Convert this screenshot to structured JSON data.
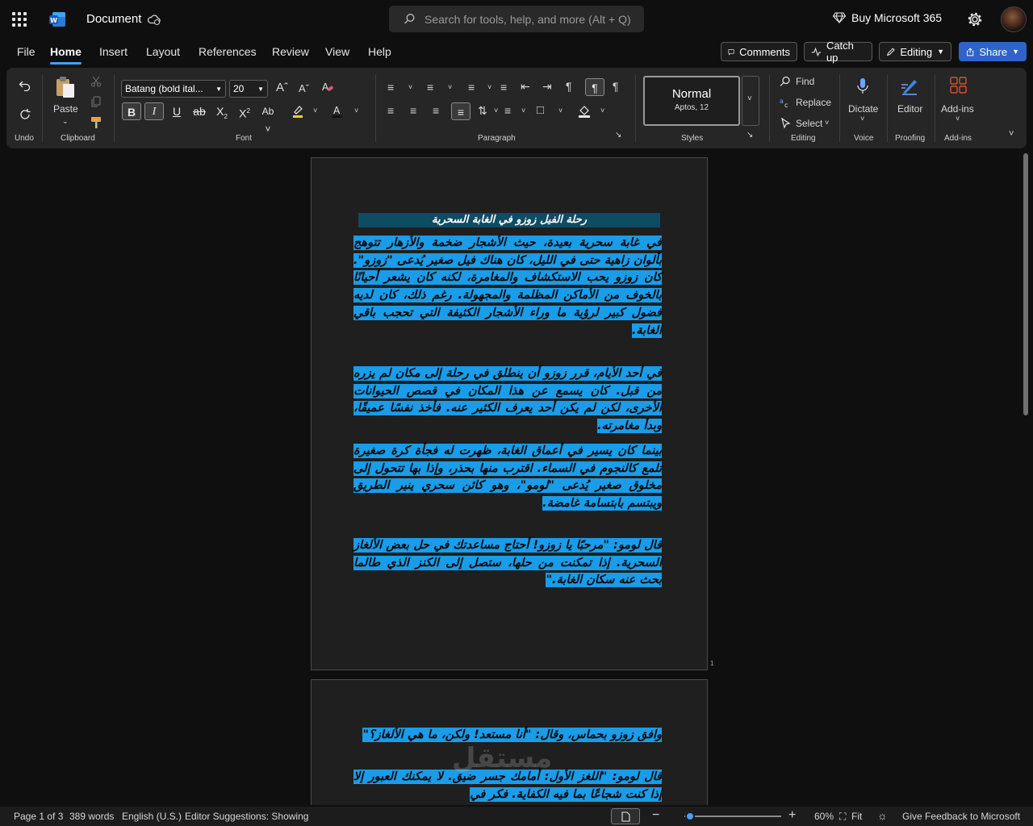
{
  "app": {
    "doc_title": "Document",
    "search_placeholder": "Search for tools, help, and more (Alt + Q)",
    "buy_label": "Buy Microsoft 365"
  },
  "tabs": [
    "File",
    "Home",
    "Insert",
    "Layout",
    "References",
    "Review",
    "View",
    "Help"
  ],
  "header_buttons": {
    "comments": "Comments",
    "catch_up": "Catch up",
    "editing": "Editing",
    "share": "Share"
  },
  "ribbon": {
    "undo_label": "Undo",
    "paste_label": "Paste",
    "clipboard_label": "Clipboard",
    "font_name": "Batang (bold ital...",
    "font_size": "20",
    "font_label": "Font",
    "paragraph_label": "Paragraph",
    "style_name": "Normal",
    "style_sub": "Aptos, 12",
    "styles_label": "Styles",
    "find_label": "Find",
    "replace_label": "Replace",
    "select_label": "Select",
    "editing_label": "Editing",
    "dictate_label": "Dictate",
    "voice_label": "Voice",
    "editor_label": "Editor",
    "proofing_label": "Proofing",
    "addins_btn": "Add-ins",
    "addins_label": "Add-ins"
  },
  "document": {
    "heading": "رحلة الفيل زوزو في الغابة السحرية",
    "page1_paragraphs": [
      "في غابة سحرية بعيدة، حيث الأشجار ضخمة والأزهار تتوهج بألوان زاهية حتى في الليل، كان هناك فيل صغير يُدعى \"زوزو\". كان زوزو يحب الاستكشاف والمغامرة، لكنه كان يشعر أحيانًا بالخوف من الأماكن المظلمة والمجهولة. رغم ذلك، كان لديه فضول كبير لرؤية ما وراء الأشجار الكثيفة التي تحجب باقي الغابة.",
      "في أحد الأيام، قرر زوزو أن ينطلق في رحلة إلى مكان لم يزره من قبل. كان يسمع عن هذا المكان في قصص الحيوانات الأخرى، لكن لم يكن أحد يعرف الكثير عنه. فأخذ نفسًا عميقًا، وبدأ مغامرته.",
      "بينما كان يسير في أعماق الغابة، ظهرت له فجأة كرة صغيرة تلمع كالنجوم في السماء. اقترب منها بحذر، وإذا بها تتحول إلى مخلوق صغير يُدعى \"لومو\"، وهو كائن سحري ينير الطريق ويبتسم بابتسامة غامضة.",
      "قال لومو: \"مرحبًا يا زوزو! أحتاج مساعدتك في حل بعض الألغاز السحرية. إذا تمكنت من حلها، ستصل إلى الكنز الذي طالما بحث عنه سكان الغابة.\""
    ],
    "page2_paragraphs": [
      "وافق زوزو بحماس، وقال: \"أنا مستعد! ولكن، ما هي الألغاز؟\"",
      "قال لومو: \"اللغز الأول: أمامك جسر ضيق. لا يمكنك العبور إلا إذا كنت شجاعًا بما فيه الكفاية. فكر في"
    ],
    "page_number": "1"
  },
  "watermark": "مستقل",
  "status": {
    "page": "Page 1 of 3",
    "words": "389 words",
    "language": "English (U.S.)",
    "editor": "Editor Suggestions: Showing",
    "zoom": "60%",
    "fit": "Fit",
    "feedback": "Give Feedback to Microsoft",
    "zoom_level": 0.6
  },
  "colors": {
    "accent": "#479ef5",
    "selection": "#1a9ce8",
    "heading_bg": "#0c4d63",
    "share_bg": "#2f63c8"
  }
}
